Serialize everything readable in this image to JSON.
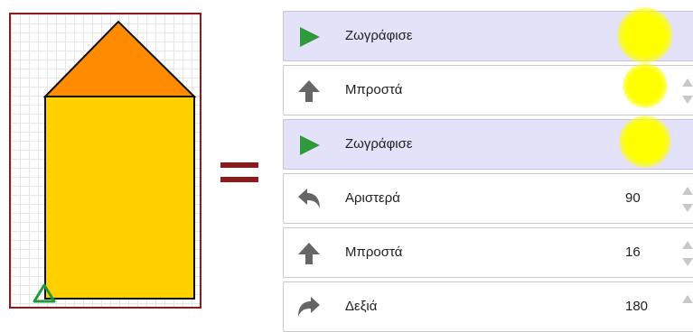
{
  "canvas": {
    "border_color": "#8b1c1c",
    "roof_color": "#ff8c00",
    "wall_color": "#ffd000",
    "turtle_color": "#1f9a3a"
  },
  "equals_sign": "=",
  "blocks": [
    {
      "type": "draw",
      "icon": "play-icon",
      "label": "Ζωγράφισε",
      "value": null,
      "highlighted": true
    },
    {
      "type": "forward",
      "icon": "arrow-up-icon",
      "label": "Μπροστά",
      "value": null,
      "highlighted": true
    },
    {
      "type": "draw",
      "icon": "play-icon",
      "label": "Ζωγράφισε",
      "value": null,
      "highlighted": true
    },
    {
      "type": "turn-left",
      "icon": "turn-left-icon",
      "label": "Αριστερά",
      "value": "90",
      "highlighted": false
    },
    {
      "type": "forward",
      "icon": "arrow-up-icon",
      "label": "Μπροστά",
      "value": "16",
      "highlighted": false
    },
    {
      "type": "turn-right",
      "icon": "turn-right-icon",
      "label": "Δεξιά",
      "value": "180",
      "highlighted": false
    }
  ],
  "colors": {
    "draw_block_bg": "#e4e2f8",
    "play_icon": "#2e9a3c",
    "arrow_icon": "#666666",
    "highlight": "#ffff00"
  }
}
